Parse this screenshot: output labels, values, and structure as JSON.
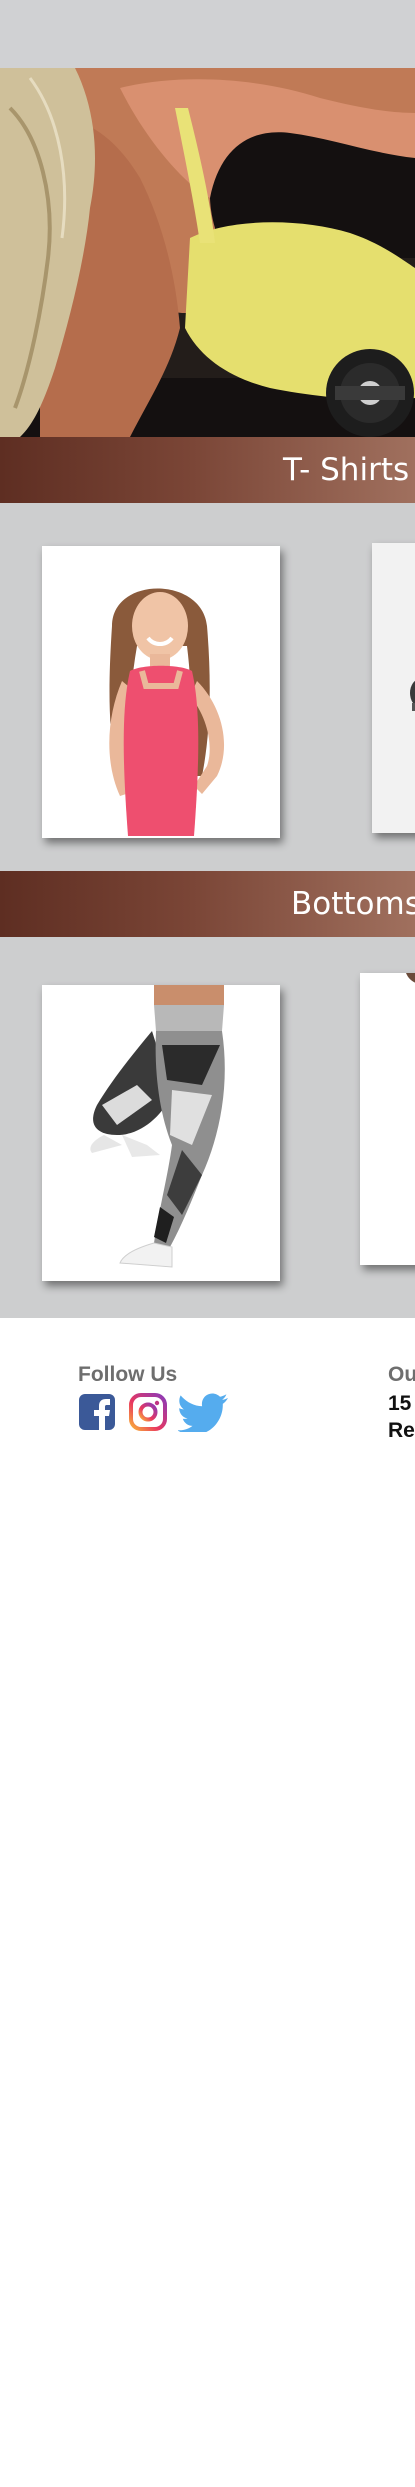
{
  "sections": [
    {
      "title": "T- Shirts",
      "products": [
        {
          "name": "pink-tank-top"
        },
        {
          "name": "tshirt-second"
        }
      ]
    },
    {
      "title": "Bottoms",
      "products": [
        {
          "name": "geometric-leggings"
        },
        {
          "name": "bottoms-second"
        }
      ]
    }
  ],
  "footer": {
    "follow_title": "Follow Us",
    "address_title": "Ou",
    "address_line1": "15",
    "address_line2": "Re",
    "social_icons": [
      "facebook-icon",
      "instagram-icon",
      "twitter-icon"
    ]
  },
  "colors": {
    "banner": "#7a4536",
    "band": "#cdcecf",
    "facebook": "#3b5998",
    "twitter": "#55acee"
  }
}
